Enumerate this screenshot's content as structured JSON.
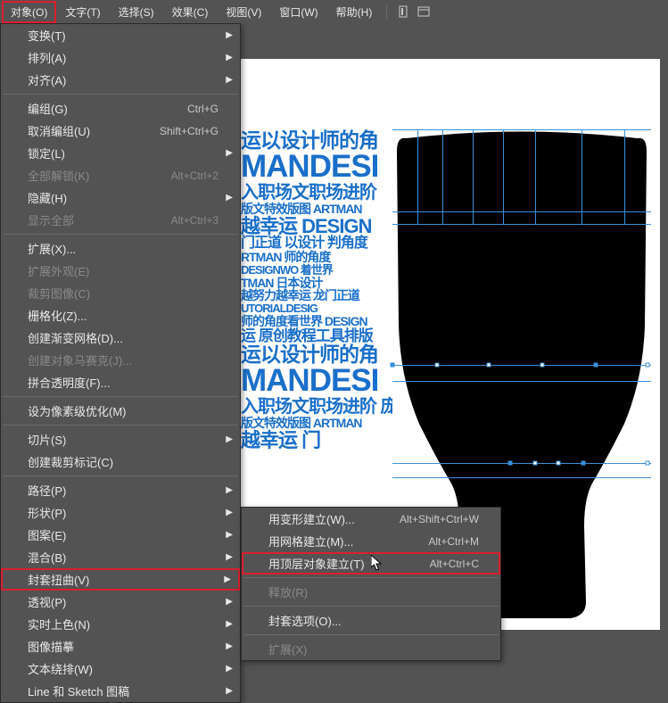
{
  "menubar": {
    "items": [
      "对象(O)",
      "文字(T)",
      "选择(S)",
      "效果(C)",
      "视图(V)",
      "窗口(W)",
      "帮助(H)"
    ]
  },
  "dropdown": {
    "groups": [
      [
        {
          "label": "变换(T)",
          "arrow": true
        },
        {
          "label": "排列(A)",
          "arrow": true
        },
        {
          "label": "对齐(A)",
          "arrow": true
        }
      ],
      [
        {
          "label": "编组(G)",
          "shortcut": "Ctrl+G"
        },
        {
          "label": "取消编组(U)",
          "shortcut": "Shift+Ctrl+G"
        },
        {
          "label": "锁定(L)",
          "arrow": true
        },
        {
          "label": "全部解锁(K)",
          "shortcut": "Alt+Ctrl+2",
          "disabled": true
        },
        {
          "label": "隐藏(H)",
          "arrow": true
        },
        {
          "label": "显示全部",
          "shortcut": "Alt+Ctrl+3",
          "disabled": true
        }
      ],
      [
        {
          "label": "扩展(X)..."
        },
        {
          "label": "扩展外观(E)",
          "disabled": true
        },
        {
          "label": "裁剪图像(C)",
          "disabled": true
        },
        {
          "label": "栅格化(Z)..."
        },
        {
          "label": "创建渐变网格(D)..."
        },
        {
          "label": "创建对象马赛克(J)...",
          "disabled": true
        },
        {
          "label": "拼合透明度(F)..."
        }
      ],
      [
        {
          "label": "设为像素级优化(M)"
        }
      ],
      [
        {
          "label": "切片(S)",
          "arrow": true
        },
        {
          "label": "创建裁剪标记(C)"
        }
      ],
      [
        {
          "label": "路径(P)",
          "arrow": true
        },
        {
          "label": "形状(P)",
          "arrow": true
        },
        {
          "label": "图案(E)",
          "arrow": true
        },
        {
          "label": "混合(B)",
          "arrow": true
        },
        {
          "label": "封套扭曲(V)",
          "arrow": true,
          "highlight": true
        },
        {
          "label": "透视(P)",
          "arrow": true
        },
        {
          "label": "实时上色(N)",
          "arrow": true
        },
        {
          "label": "图像描摹",
          "arrow": true
        },
        {
          "label": "文本绕排(W)",
          "arrow": true
        },
        {
          "label": "Line 和 Sketch 图稿",
          "arrow": true
        }
      ]
    ]
  },
  "submenu": {
    "groups": [
      [
        {
          "label": "用变形建立(W)...",
          "shortcut": "Alt+Shift+Ctrl+W"
        },
        {
          "label": "用网格建立(M)...",
          "shortcut": "Alt+Ctrl+M"
        },
        {
          "label": "用顶层对象建立(T)",
          "shortcut": "Alt+Ctrl+C",
          "highlight": true
        }
      ],
      [
        {
          "label": "释放(R)",
          "disabled": true
        }
      ],
      [
        {
          "label": "封套选项(O)..."
        }
      ],
      [
        {
          "label": "扩展(X)",
          "disabled": true
        }
      ]
    ]
  },
  "design_text": {
    "lines": [
      {
        "t": "运以设计师的角",
        "s": 23
      },
      {
        "t": "MANDESI",
        "s": 35
      },
      {
        "t": "入职场文职场进阶",
        "s": 20
      },
      {
        "t": "版文特效版图 ARTMAN",
        "s": 14
      },
      {
        "t": "越幸运 DESIGN",
        "s": 22
      },
      {
        "t": "门正道 以设计 判角度",
        "s": 16
      },
      {
        "t": "RTMAN 师的角度",
        "s": 14
      },
      {
        "t": "DESIGNWO 着世界",
        "s": 13
      },
      {
        "t": "TMAN 日本设计",
        "s": 14
      },
      {
        "t": "越努力越幸运 龙门正道",
        "s": 14
      },
      {
        "t": "UTORIALDESIG",
        "s": 13
      },
      {
        "t": "师的角度看世界 DESIGN",
        "s": 14
      },
      {
        "t": "运 原创教程工具排版",
        "s": 17
      },
      {
        "t": "运以设计师的角",
        "s": 23
      },
      {
        "t": "MANDESI",
        "s": 35
      },
      {
        "t": "入职场文职场进阶 庞",
        "s": 20
      },
      {
        "t": "版文特效版图 ARTMAN",
        "s": 14
      },
      {
        "t": "越幸运            门",
        "s": 22
      }
    ]
  }
}
